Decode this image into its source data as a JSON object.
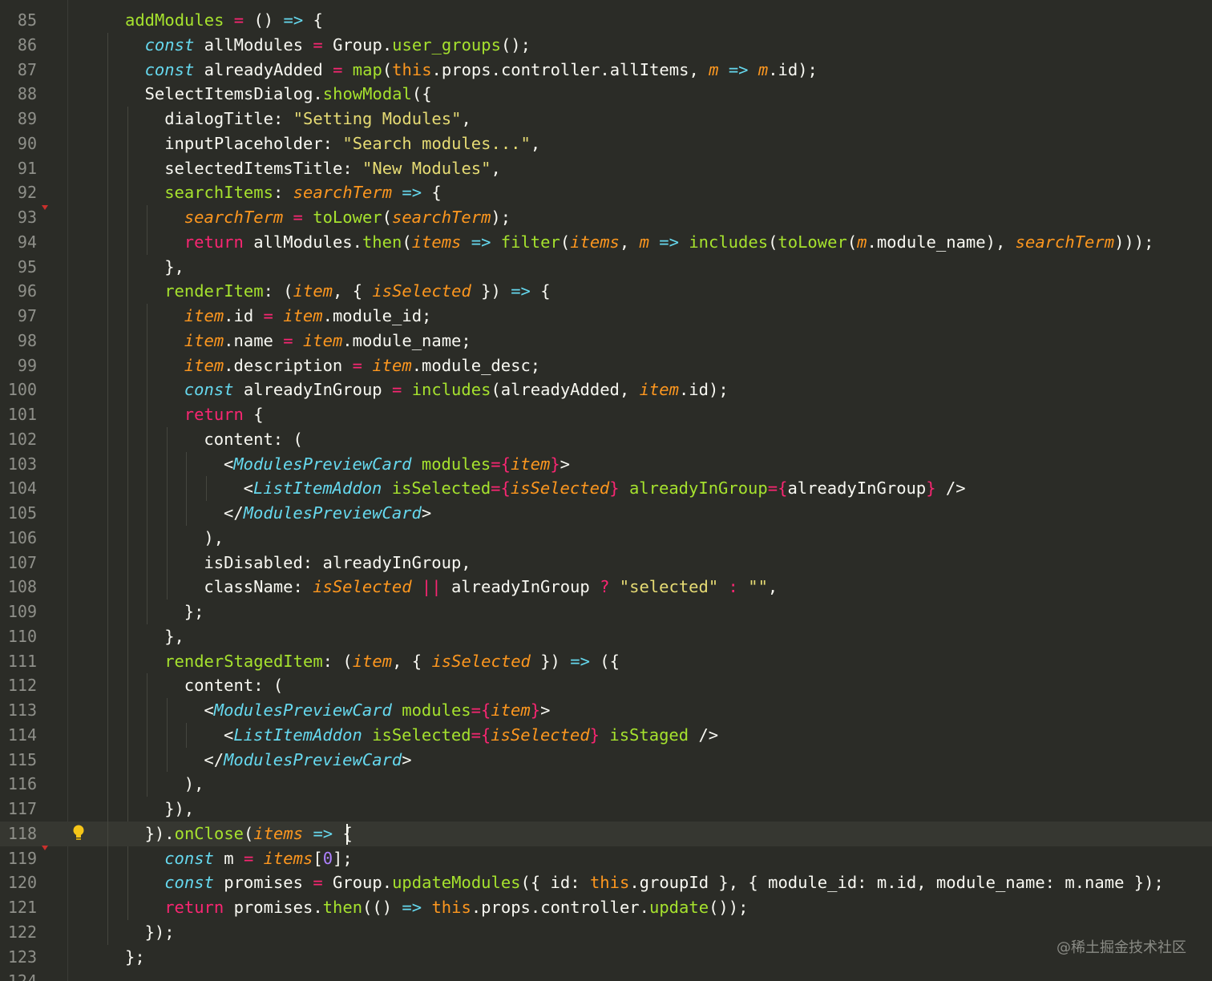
{
  "editor": {
    "theme": {
      "background": "#2b2c27",
      "current_line": "#363731"
    },
    "first_line_number": 85,
    "current_line": 118,
    "lines": [
      {
        "n": "85",
        "indent": 1,
        "tokens": [
          [
            "fn",
            "addModules"
          ],
          [
            "",
            ""
          ],
          [
            "op",
            " = "
          ],
          [
            "",
            "() "
          ],
          [
            "kw",
            "=>"
          ],
          [
            "",
            " {"
          ]
        ]
      },
      {
        "n": "86",
        "indent": 2,
        "tokens": [
          [
            "kw",
            "const"
          ],
          [
            "",
            " allModules "
          ],
          [
            "op",
            "="
          ],
          [
            "",
            " Group."
          ],
          [
            "fn",
            "user_groups"
          ],
          [
            "",
            "();"
          ]
        ]
      },
      {
        "n": "87",
        "indent": 2,
        "tokens": [
          [
            "kw",
            "const"
          ],
          [
            "",
            " alreadyAdded "
          ],
          [
            "op",
            "="
          ],
          [
            " ",
            ""
          ],
          [
            "fn",
            " map"
          ],
          [
            "",
            "("
          ],
          [
            "this",
            "this"
          ],
          [
            "",
            ".props.controller.allItems, "
          ],
          [
            "param",
            "m"
          ],
          [
            "",
            " "
          ],
          [
            "kw",
            "=>"
          ],
          [
            "",
            " "
          ],
          [
            "param",
            "m"
          ],
          [
            "",
            ".id);"
          ]
        ]
      },
      {
        "n": "88",
        "indent": 2,
        "tokens": [
          [
            "",
            "SelectItemsDialog."
          ],
          [
            "fn",
            "showModal"
          ],
          [
            "",
            "({"
          ]
        ]
      },
      {
        "n": "89",
        "indent": 3,
        "tokens": [
          [
            "",
            "dialogTitle: "
          ],
          [
            "str",
            "\"Setting Modules\""
          ],
          [
            "",
            ","
          ]
        ]
      },
      {
        "n": "90",
        "indent": 3,
        "tokens": [
          [
            "",
            "inputPlaceholder: "
          ],
          [
            "str",
            "\"Search modules...\""
          ],
          [
            "",
            ","
          ]
        ]
      },
      {
        "n": "91",
        "indent": 3,
        "tokens": [
          [
            "",
            "selectedItemsTitle: "
          ],
          [
            "str",
            "\"New Modules\""
          ],
          [
            "",
            ","
          ]
        ]
      },
      {
        "n": "92",
        "indent": 3,
        "tokens": [
          [
            "fn",
            "searchItems"
          ],
          [
            "",
            ": "
          ],
          [
            "param",
            "searchTerm"
          ],
          [
            "",
            " "
          ],
          [
            "kw",
            "=>"
          ],
          [
            "",
            " {"
          ]
        ]
      },
      {
        "n": "93",
        "indent": 4,
        "tokens": [
          [
            "param",
            "searchTerm"
          ],
          [
            "op",
            " = "
          ],
          [
            "fn",
            "toLower"
          ],
          [
            "",
            "("
          ],
          [
            "param",
            "searchTerm"
          ],
          [
            "",
            ");"
          ]
        ]
      },
      {
        "n": "94",
        "indent": 4,
        "tokens": [
          [
            "ctl",
            "return"
          ],
          [
            "",
            " allModules."
          ],
          [
            "fn",
            "then"
          ],
          [
            "",
            "("
          ],
          [
            "param",
            "items"
          ],
          [
            "",
            " "
          ],
          [
            "kw",
            "=>"
          ],
          [
            "",
            " "
          ],
          [
            "fn",
            "filter"
          ],
          [
            "",
            "("
          ],
          [
            "param",
            "items"
          ],
          [
            "",
            ", "
          ],
          [
            "param",
            "m"
          ],
          [
            "",
            " "
          ],
          [
            "kw",
            "=>"
          ],
          [
            "",
            " "
          ],
          [
            "fn",
            "includes"
          ],
          [
            "",
            "("
          ],
          [
            "fn",
            "toLower"
          ],
          [
            "",
            "("
          ],
          [
            "param",
            "m"
          ],
          [
            "",
            ".module_name), "
          ],
          [
            "param",
            "searchTerm"
          ],
          [
            "",
            ")));"
          ]
        ]
      },
      {
        "n": "95",
        "indent": 3,
        "tokens": [
          [
            "",
            "},"
          ]
        ]
      },
      {
        "n": "96",
        "indent": 3,
        "tokens": [
          [
            "fn",
            "renderItem"
          ],
          [
            "",
            ": ("
          ],
          [
            "param",
            "item"
          ],
          [
            "",
            ", { "
          ],
          [
            "param",
            "isSelected"
          ],
          [
            "",
            " }) "
          ],
          [
            "kw",
            "=>"
          ],
          [
            "",
            " {"
          ]
        ]
      },
      {
        "n": "97",
        "indent": 4,
        "tokens": [
          [
            "param",
            "item"
          ],
          [
            "",
            ".id "
          ],
          [
            "op",
            "="
          ],
          [
            "",
            " "
          ],
          [
            "param",
            "item"
          ],
          [
            "",
            ".module_id;"
          ]
        ]
      },
      {
        "n": "98",
        "indent": 4,
        "tokens": [
          [
            "param",
            "item"
          ],
          [
            "",
            ".name "
          ],
          [
            "op",
            "="
          ],
          [
            "",
            " "
          ],
          [
            "param",
            "item"
          ],
          [
            "",
            ".module_name;"
          ]
        ]
      },
      {
        "n": "99",
        "indent": 4,
        "tokens": [
          [
            "param",
            "item"
          ],
          [
            "",
            ".description "
          ],
          [
            "op",
            "="
          ],
          [
            "",
            " "
          ],
          [
            "param",
            "item"
          ],
          [
            "",
            ".module_desc;"
          ]
        ]
      },
      {
        "n": "100",
        "indent": 4,
        "tokens": [
          [
            "kw",
            "const"
          ],
          [
            "",
            " alreadyInGroup "
          ],
          [
            "op",
            "="
          ],
          [
            "",
            " "
          ],
          [
            "fn",
            "includes"
          ],
          [
            "",
            "(alreadyAdded, "
          ],
          [
            "param",
            "item"
          ],
          [
            "",
            ".id);"
          ]
        ]
      },
      {
        "n": "101",
        "indent": 4,
        "tokens": [
          [
            "ctl",
            "return"
          ],
          [
            "",
            " {"
          ]
        ]
      },
      {
        "n": "102",
        "indent": 5,
        "tokens": [
          [
            "",
            "content: ("
          ]
        ]
      },
      {
        "n": "103",
        "indent": 6,
        "tokens": [
          [
            "",
            "<"
          ],
          [
            "comp",
            "ModulesPreviewCard"
          ],
          [
            "",
            " "
          ],
          [
            "attr",
            "modules"
          ],
          [
            "op",
            "={"
          ],
          [
            "param",
            "item"
          ],
          [
            "op",
            "}"
          ],
          [
            "",
            ">"
          ]
        ]
      },
      {
        "n": "104",
        "indent": 7,
        "tokens": [
          [
            "",
            "<"
          ],
          [
            "comp",
            "ListItemAddon"
          ],
          [
            "",
            " "
          ],
          [
            "attr",
            "isSelected"
          ],
          [
            "op",
            "={"
          ],
          [
            "param",
            "isSelected"
          ],
          [
            "op",
            "}"
          ],
          [
            "",
            " "
          ],
          [
            "attr",
            "alreadyInGroup"
          ],
          [
            "op",
            "={"
          ],
          [
            "",
            "alreadyInGroup"
          ],
          [
            "op",
            "}"
          ],
          [
            "",
            " />"
          ]
        ]
      },
      {
        "n": "105",
        "indent": 6,
        "tokens": [
          [
            "",
            "</"
          ],
          [
            "comp",
            "ModulesPreviewCard"
          ],
          [
            "",
            ">"
          ]
        ]
      },
      {
        "n": "106",
        "indent": 5,
        "tokens": [
          [
            "",
            "),"
          ]
        ]
      },
      {
        "n": "107",
        "indent": 5,
        "tokens": [
          [
            "",
            "isDisabled: alreadyInGroup,"
          ]
        ]
      },
      {
        "n": "108",
        "indent": 5,
        "tokens": [
          [
            "",
            "className: "
          ],
          [
            "param",
            "isSelected"
          ],
          [
            "op",
            " || "
          ],
          [
            "",
            "alreadyInGroup "
          ],
          [
            "op",
            "?"
          ],
          [
            "",
            " "
          ],
          [
            "str",
            "\"selected\""
          ],
          [
            "op",
            " : "
          ],
          [
            "str",
            "\"\""
          ],
          [
            "",
            ","
          ]
        ]
      },
      {
        "n": "109",
        "indent": 4,
        "tokens": [
          [
            "",
            "};"
          ]
        ]
      },
      {
        "n": "110",
        "indent": 3,
        "tokens": [
          [
            "",
            "},"
          ]
        ]
      },
      {
        "n": "111",
        "indent": 3,
        "tokens": [
          [
            "fn",
            "renderStagedItem"
          ],
          [
            "",
            ": ("
          ],
          [
            "param",
            "item"
          ],
          [
            "",
            ", { "
          ],
          [
            "param",
            "isSelected"
          ],
          [
            "",
            " }) "
          ],
          [
            "kw",
            "=>"
          ],
          [
            "",
            " ({"
          ]
        ]
      },
      {
        "n": "112",
        "indent": 4,
        "tokens": [
          [
            "",
            "content: ("
          ]
        ]
      },
      {
        "n": "113",
        "indent": 5,
        "tokens": [
          [
            "",
            "<"
          ],
          [
            "comp",
            "ModulesPreviewCard"
          ],
          [
            "",
            " "
          ],
          [
            "attr",
            "modules"
          ],
          [
            "op",
            "={"
          ],
          [
            "param",
            "item"
          ],
          [
            "op",
            "}"
          ],
          [
            "",
            ">"
          ]
        ]
      },
      {
        "n": "114",
        "indent": 6,
        "tokens": [
          [
            "",
            "<"
          ],
          [
            "comp",
            "ListItemAddon"
          ],
          [
            "",
            " "
          ],
          [
            "attr",
            "isSelected"
          ],
          [
            "op",
            "={"
          ],
          [
            "param",
            "isSelected"
          ],
          [
            "op",
            "}"
          ],
          [
            "",
            " "
          ],
          [
            "attr",
            "isStaged"
          ],
          [
            "",
            " />"
          ]
        ]
      },
      {
        "n": "115",
        "indent": 5,
        "tokens": [
          [
            "",
            "</"
          ],
          [
            "comp",
            "ModulesPreviewCard"
          ],
          [
            "",
            ">"
          ]
        ]
      },
      {
        "n": "116",
        "indent": 4,
        "tokens": [
          [
            "",
            "),"
          ]
        ]
      },
      {
        "n": "117",
        "indent": 3,
        "tokens": [
          [
            "",
            "}),"
          ]
        ]
      },
      {
        "n": "118",
        "indent": 2,
        "tokens": [
          [
            "",
            "})."
          ],
          [
            "fn",
            "onClose"
          ],
          [
            "",
            "("
          ],
          [
            "param",
            "items"
          ],
          [
            "",
            " "
          ],
          [
            "kw",
            "=>"
          ],
          [
            "",
            " {"
          ]
        ]
      },
      {
        "n": "119",
        "indent": 3,
        "tokens": [
          [
            "kw",
            "const"
          ],
          [
            "",
            " m "
          ],
          [
            "op",
            "="
          ],
          [
            "",
            " "
          ],
          [
            "param",
            "items"
          ],
          [
            "",
            "["
          ],
          [
            "num",
            "0"
          ],
          [
            "",
            "];"
          ]
        ]
      },
      {
        "n": "120",
        "indent": 3,
        "tokens": [
          [
            "kw",
            "const"
          ],
          [
            "",
            " promises "
          ],
          [
            "op",
            "="
          ],
          [
            "",
            " Group."
          ],
          [
            "fn",
            "updateModules"
          ],
          [
            "",
            "({ id: "
          ],
          [
            "this",
            "this"
          ],
          [
            "",
            ".groupId }, { module_id: m.id, module_name: m.name });"
          ]
        ]
      },
      {
        "n": "121",
        "indent": 3,
        "tokens": [
          [
            "ctl",
            "return"
          ],
          [
            "",
            " promises."
          ],
          [
            "fn",
            "then"
          ],
          [
            "",
            "(() "
          ],
          [
            "kw",
            "=>"
          ],
          [
            "",
            " "
          ],
          [
            "this",
            "this"
          ],
          [
            "",
            ".props.controller."
          ],
          [
            "fn",
            "update"
          ],
          [
            "",
            "());"
          ]
        ]
      },
      {
        "n": "122",
        "indent": 2,
        "tokens": [
          [
            "",
            "});"
          ]
        ]
      },
      {
        "n": "123",
        "indent": 1,
        "tokens": [
          [
            "",
            "};"
          ]
        ]
      },
      {
        "n": "124",
        "indent": 0,
        "tokens": []
      }
    ]
  },
  "watermark": "@稀土掘金技术社区"
}
